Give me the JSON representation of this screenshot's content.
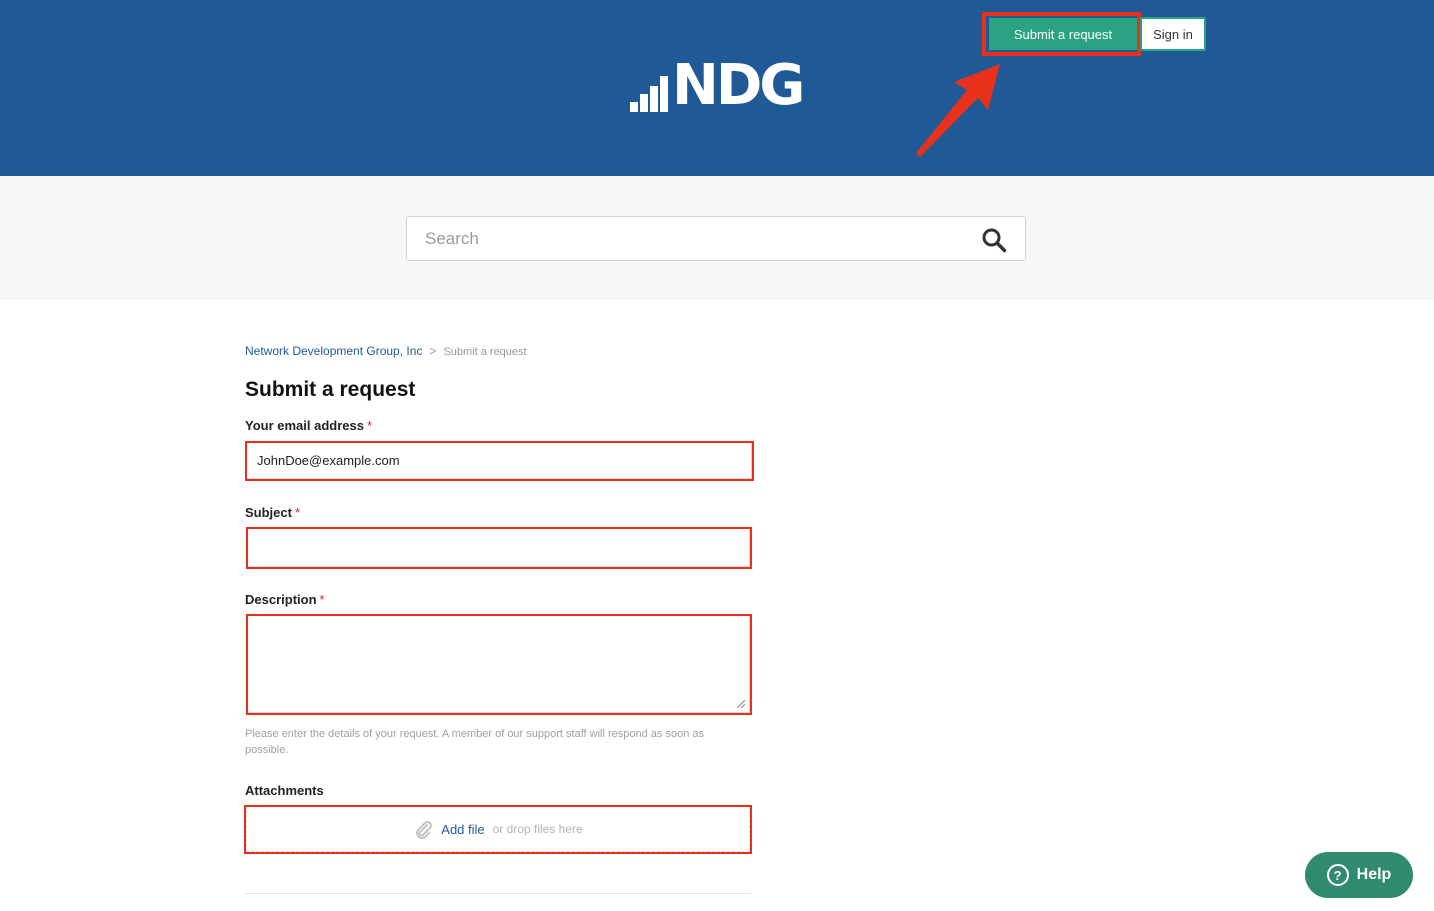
{
  "header": {
    "logo_text": "NDG",
    "submit_label": "Submit a request",
    "signin_label": "Sign in"
  },
  "search": {
    "placeholder": "Search"
  },
  "breadcrumb": {
    "home": "Network Development Group, Inc",
    "separator": ">",
    "current": "Submit a request"
  },
  "form": {
    "title": "Submit a request",
    "email": {
      "label": "Your email address",
      "required_mark": "*",
      "value": "JohnDoe@example.com"
    },
    "subject": {
      "label": "Subject",
      "required_mark": "*",
      "value": ""
    },
    "description": {
      "label": "Description",
      "required_mark": "*",
      "value": "",
      "hint": "Please enter the details of your request. A member of our support staff will respond as soon as possible."
    },
    "attachments": {
      "label": "Attachments",
      "add_file": "Add file",
      "drop_text": "or drop files here"
    }
  },
  "help_widget": {
    "icon_glyph": "?",
    "label": "Help"
  },
  "colors": {
    "header_bg": "#1f5a96",
    "accent_green": "#2ba383",
    "highlight_red": "#e8311a",
    "link_blue": "#1f5a96"
  },
  "icons": [
    "logo-bars-icon",
    "search-icon",
    "paperclip-icon",
    "help-question-icon",
    "annotation-arrow-icon",
    "resize-handle-icon"
  ]
}
